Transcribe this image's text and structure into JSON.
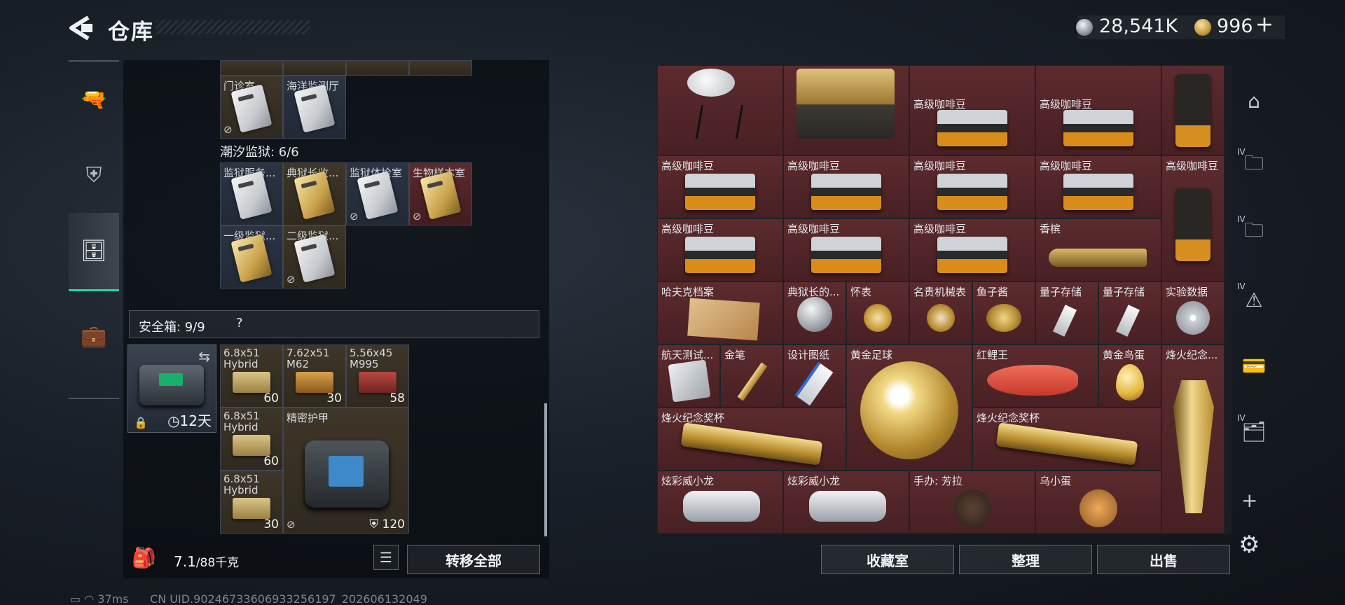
{
  "header": {
    "title": "仓库",
    "currency_silver": "28,541K",
    "currency_gold": "996",
    "currency_gold_plus": "+"
  },
  "left_panel": {
    "top_cells": [
      {
        "name": "门诊室",
        "style": "gold"
      },
      {
        "name": "海洋监测厅",
        "style": "blue"
      }
    ],
    "prison_label": "潮汐监狱: 6/6",
    "prison_cards": [
      {
        "name": "监狱服务...",
        "style": "blue",
        "card": "silver"
      },
      {
        "name": "典狱长收...",
        "style": "gold",
        "card": "gold"
      },
      {
        "name": "监狱体检室",
        "style": "blue",
        "card": "silver"
      },
      {
        "name": "生物样本室",
        "style": "red",
        "card": "gold"
      },
      {
        "name": "一级监狱...",
        "style": "blue",
        "card": "silver"
      },
      {
        "name": "二级监狱...",
        "style": "gold",
        "card": "silver"
      }
    ],
    "safe_label": "安全箱: 9/9",
    "safe_help": "?",
    "safebox_days": "12天",
    "safe_items": [
      {
        "name": "6.8x51 Hybrid",
        "count": "60"
      },
      {
        "name": "7.62x51 M62",
        "count": "30"
      },
      {
        "name": "5.56x45 M995",
        "count": "58"
      },
      {
        "name": "6.8x51 Hybrid",
        "count": "60"
      },
      {
        "name": "精密护甲",
        "count": "120"
      },
      {
        "name": "6.8x51 Hybrid",
        "count": "30"
      }
    ],
    "weight_current": "7.1",
    "weight_max": "/88千克",
    "transfer_all": "转移全部"
  },
  "right_grid": [
    {
      "name": "",
      "kind": "dish"
    },
    {
      "name": "",
      "kind": "crate"
    },
    {
      "name": "高级咖啡豆",
      "kind": "coffee"
    },
    {
      "name": "高级咖啡豆",
      "kind": "coffee"
    },
    {
      "name": "",
      "kind": "bag"
    },
    {
      "name": "高级咖啡豆",
      "kind": "coffee"
    },
    {
      "name": "高级咖啡豆",
      "kind": "coffee"
    },
    {
      "name": "高级咖啡豆",
      "kind": "coffee"
    },
    {
      "name": "高级咖啡豆",
      "kind": "coffee"
    },
    {
      "name": "高级咖啡豆",
      "kind": "bag"
    },
    {
      "name": "高级咖啡豆",
      "kind": "coffee"
    },
    {
      "name": "高级咖啡豆",
      "kind": "coffee"
    },
    {
      "name": "高级咖啡豆",
      "kind": "coffee"
    },
    {
      "name": "香槟",
      "kind": "bottle"
    },
    {
      "name": "哈夫克档案",
      "kind": "file"
    },
    {
      "name": "典狱长的...",
      "kind": "medal"
    },
    {
      "name": "怀表",
      "kind": "watch"
    },
    {
      "name": "名贵机械表",
      "kind": "watch"
    },
    {
      "name": "鱼子酱",
      "kind": "can"
    },
    {
      "name": "量子存储",
      "kind": "usb"
    },
    {
      "name": "量子存储",
      "kind": "usb"
    },
    {
      "name": "实验数据",
      "kind": "disc"
    },
    {
      "name": "航天测试...",
      "kind": "drive"
    },
    {
      "name": "金笔",
      "kind": "pen"
    },
    {
      "name": "设计图纸",
      "kind": "paper"
    },
    {
      "name": "黄金足球",
      "kind": "ball"
    },
    {
      "name": "红鲤王",
      "kind": "fish"
    },
    {
      "name": "黄金鸟蛋",
      "kind": "egg"
    },
    {
      "name": "烽火纪念...",
      "kind": "trophy"
    },
    {
      "name": "烽火纪念奖杯",
      "kind": "trophy_h"
    },
    {
      "name": "烽火纪念奖杯",
      "kind": "trophy_h"
    },
    {
      "name": "炫彩威小龙",
      "kind": "glove"
    },
    {
      "name": "炫彩威小龙",
      "kind": "glove"
    },
    {
      "name": "手办: 芳拉",
      "kind": "figure"
    },
    {
      "name": "乌小蛋",
      "kind": "figure"
    }
  ],
  "buttons": {
    "collection": "收藏室",
    "sort": "整理",
    "sell": "出售"
  },
  "right_icons": [
    {
      "icon": "gate-icon",
      "tier": ""
    },
    {
      "icon": "folder-icon",
      "tier": "IV"
    },
    {
      "icon": "folder-icon",
      "tier": "IV"
    },
    {
      "icon": "warning-frame-icon",
      "tier": "IV"
    },
    {
      "icon": "key-card-icon",
      "tier": ""
    },
    {
      "icon": "plus-case-icon",
      "tier": "IV"
    }
  ],
  "status_bar": {
    "ping": "37ms",
    "uid": "CN UID.90246733606933256197_202606132049"
  },
  "colors": {
    "accent_green": "#2bd69b",
    "item_red_bg": "#5c2b2e"
  }
}
